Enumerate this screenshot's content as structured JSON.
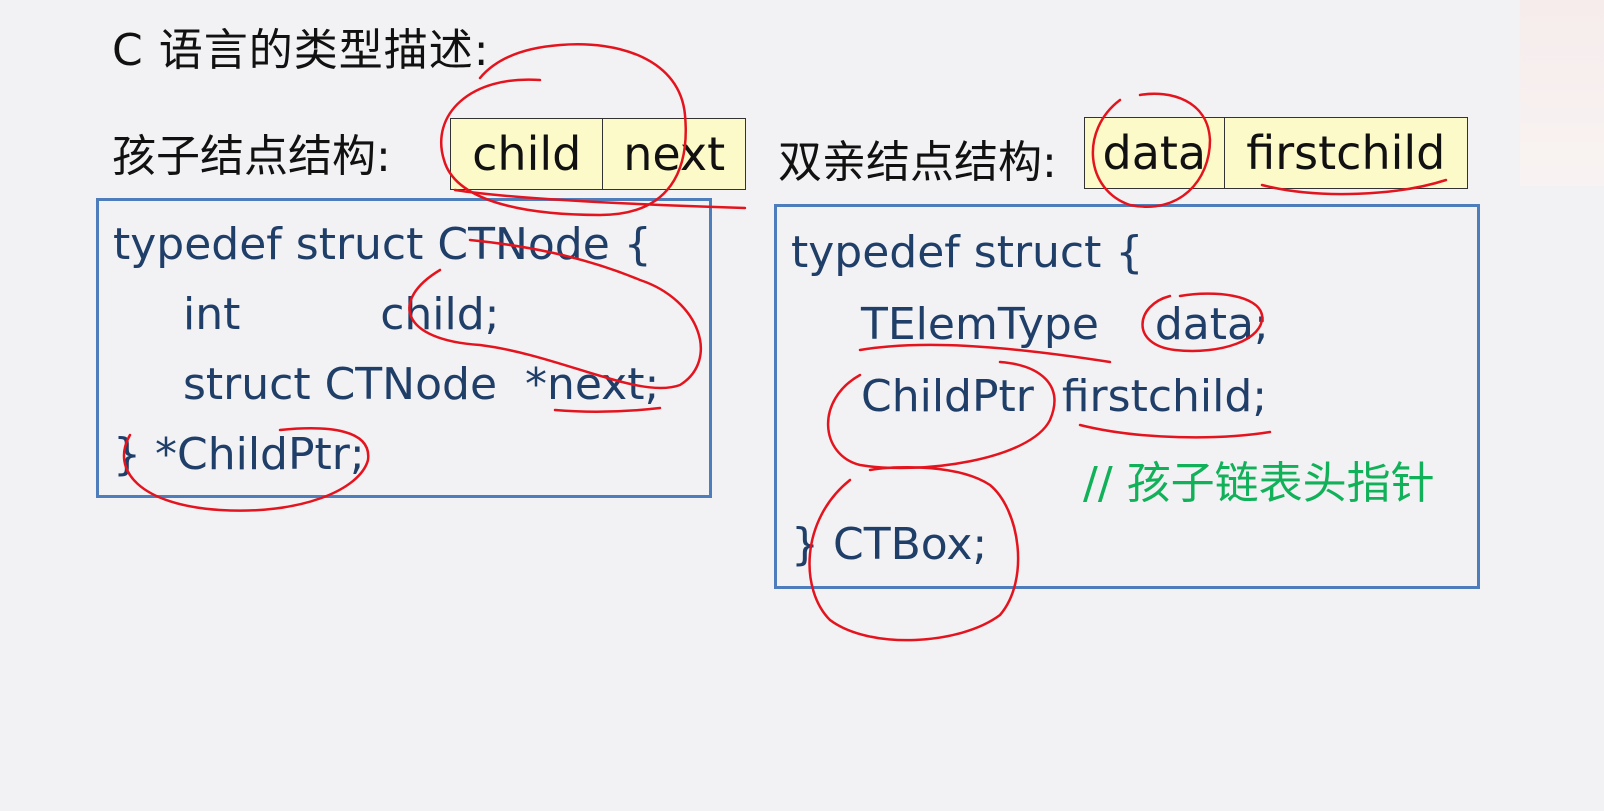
{
  "title": "C 语言的类型描述:",
  "child_struct_label": "孩子结点结构:",
  "child_cells": [
    "child",
    "next"
  ],
  "parent_struct_label": "双亲结点结构:",
  "parent_cells": [
    "data",
    "firstchild"
  ],
  "left_code": [
    "typedef struct CTNode {",
    "int          child;",
    "struct CTNode  *next;",
    "} *ChildPtr;"
  ],
  "right_code": [
    "typedef struct {",
    "TElemType    data;",
    "ChildPtr  firstchild;",
    "// 孩子链表头指针",
    "} CTBox;"
  ],
  "annotation_color": "#e4141e",
  "code_color": "#1f3e68",
  "comment_color": "#11b15a",
  "box_border_color": "#4e7dbc",
  "cell_fill_color": "#fcfac8"
}
